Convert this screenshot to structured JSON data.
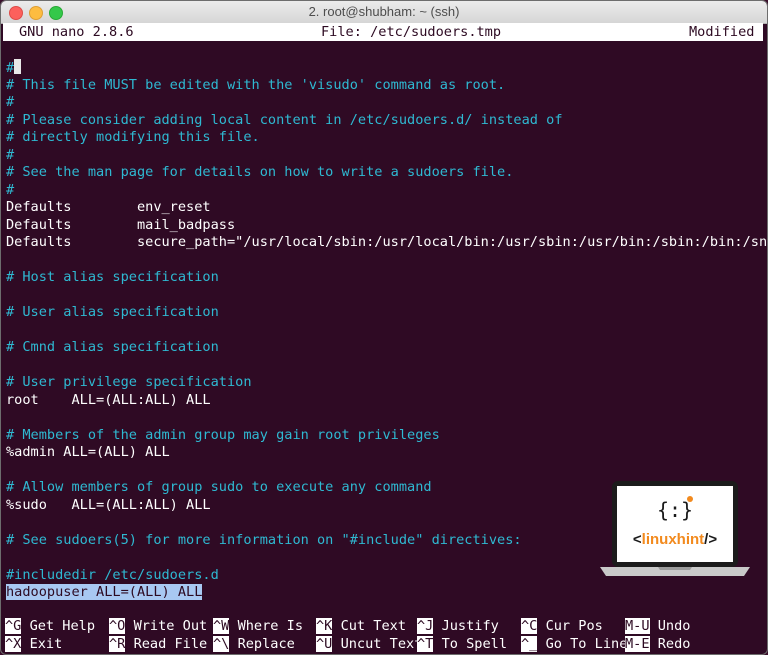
{
  "window": {
    "title": "2. root@shubham: ~ (ssh)"
  },
  "nano": {
    "version": "GNU nano 2.8.6",
    "file": "File: /etc/sudoers.tmp",
    "status": "Modified"
  },
  "lines": [
    {
      "text": "#",
      "type": "comment",
      "cursor": true
    },
    {
      "text": "# This file MUST be edited with the 'visudo' command as root.",
      "type": "comment"
    },
    {
      "text": "#",
      "type": "comment"
    },
    {
      "text": "# Please consider adding local content in /etc/sudoers.d/ instead of",
      "type": "comment"
    },
    {
      "text": "# directly modifying this file.",
      "type": "comment"
    },
    {
      "text": "#",
      "type": "comment"
    },
    {
      "text": "# See the man page for details on how to write a sudoers file.",
      "type": "comment"
    },
    {
      "text": "#",
      "type": "comment"
    },
    {
      "text": "Defaults        env_reset",
      "type": "plain"
    },
    {
      "text": "Defaults        mail_badpass",
      "type": "plain"
    },
    {
      "text": "Defaults        secure_path=\"/usr/local/sbin:/usr/local/bin:/usr/sbin:/usr/bin:/sbin:/bin:/snap/bin\"",
      "type": "plain"
    },
    {
      "text": "",
      "type": "plain"
    },
    {
      "text": "# Host alias specification",
      "type": "comment"
    },
    {
      "text": "",
      "type": "plain"
    },
    {
      "text": "# User alias specification",
      "type": "comment"
    },
    {
      "text": "",
      "type": "plain"
    },
    {
      "text": "# Cmnd alias specification",
      "type": "comment"
    },
    {
      "text": "",
      "type": "plain"
    },
    {
      "text": "# User privilege specification",
      "type": "comment"
    },
    {
      "text": "root    ALL=(ALL:ALL) ALL",
      "type": "plain"
    },
    {
      "text": "",
      "type": "plain"
    },
    {
      "text": "# Members of the admin group may gain root privileges",
      "type": "comment"
    },
    {
      "text": "%admin ALL=(ALL) ALL",
      "type": "plain"
    },
    {
      "text": "",
      "type": "plain"
    },
    {
      "text": "# Allow members of group sudo to execute any command",
      "type": "comment"
    },
    {
      "text": "%sudo   ALL=(ALL:ALL) ALL",
      "type": "plain"
    },
    {
      "text": "",
      "type": "plain"
    },
    {
      "text": "# See sudoers(5) for more information on \"#include\" directives:",
      "type": "comment"
    },
    {
      "text": "",
      "type": "plain"
    },
    {
      "text": "#includedir /etc/sudoers.d",
      "type": "comment"
    },
    {
      "text": "hadoopuser ALL=(ALL) ALL",
      "type": "plain",
      "selected": true
    }
  ],
  "shortcuts": [
    {
      "key": "^G",
      "label": "Get Help"
    },
    {
      "key": "^X",
      "label": "Exit"
    },
    {
      "key": "^O",
      "label": "Write Out"
    },
    {
      "key": "^R",
      "label": "Read File"
    },
    {
      "key": "^W",
      "label": "Where Is"
    },
    {
      "key": "^\\",
      "label": "Replace"
    },
    {
      "key": "^K",
      "label": "Cut Text"
    },
    {
      "key": "^U",
      "label": "Uncut Text"
    },
    {
      "key": "^J",
      "label": "Justify"
    },
    {
      "key": "^T",
      "label": "To Spell"
    },
    {
      "key": "^C",
      "label": "Cur Pos"
    },
    {
      "key": "^_",
      "label": "Go To Line"
    },
    {
      "key": "M-U",
      "label": "Undo"
    },
    {
      "key": "M-E",
      "label": "Redo"
    }
  ],
  "logo": {
    "text": "linuxhint",
    "left": "<",
    "right": "/>",
    "accent": "#f28a1e"
  },
  "colors": {
    "background": "#2f0a24",
    "comment": "#2fb9d2",
    "text": "#ffffff",
    "selection": "#a8c8f2"
  }
}
